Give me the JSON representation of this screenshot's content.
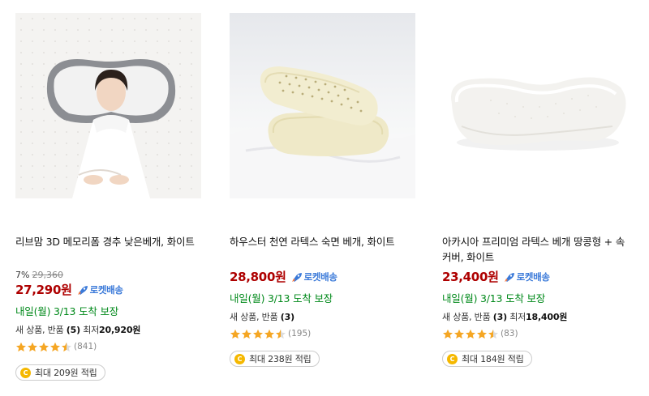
{
  "products": [
    {
      "title": "리브맘 3D 메모리폼 경추 낮은베개, 화이트",
      "discount_rate": "7%",
      "original_price": "29,360",
      "price": "27,290원",
      "rocket_label": "로켓배송",
      "arrival": "내일(월) 3/13 도착 보장",
      "new_used_label": "새 상품, 반품",
      "new_used_count": "(5)",
      "lowest_label": "최저",
      "lowest_price": "20,920원",
      "rating": 4.5,
      "review_count": "(841)",
      "cashback": "최대 209원 적립"
    },
    {
      "title": "하우스터 천연 라텍스 숙면 베개, 화이트",
      "price": "28,800원",
      "rocket_label": "로켓배송",
      "arrival": "내일(월) 3/13 도착 보장",
      "new_used_label": "새 상품, 반품",
      "new_used_count": "(3)",
      "rating": 4.5,
      "review_count": "(195)",
      "cashback": "최대 238원 적립"
    },
    {
      "title": "아카시아 프리미엄 라텍스 베개 땅콩형 + 속커버, 화이트",
      "price": "23,400원",
      "rocket_label": "로켓배송",
      "arrival": "내일(월) 3/13 도착 보장",
      "new_used_label": "새 상품, 반품",
      "new_used_count": "(3)",
      "lowest_label": "최저",
      "lowest_price": "18,400원",
      "rating": 4.5,
      "review_count": "(83)",
      "cashback": "최대 184원 적립"
    }
  ],
  "colors": {
    "price": "#ae0000",
    "rocket": "#3b7ad9",
    "arrival": "#00891a",
    "star": "#f5a623",
    "coin": "#f5b800"
  },
  "icons": [
    "rocket-icon",
    "star-icon",
    "coin-icon"
  ]
}
